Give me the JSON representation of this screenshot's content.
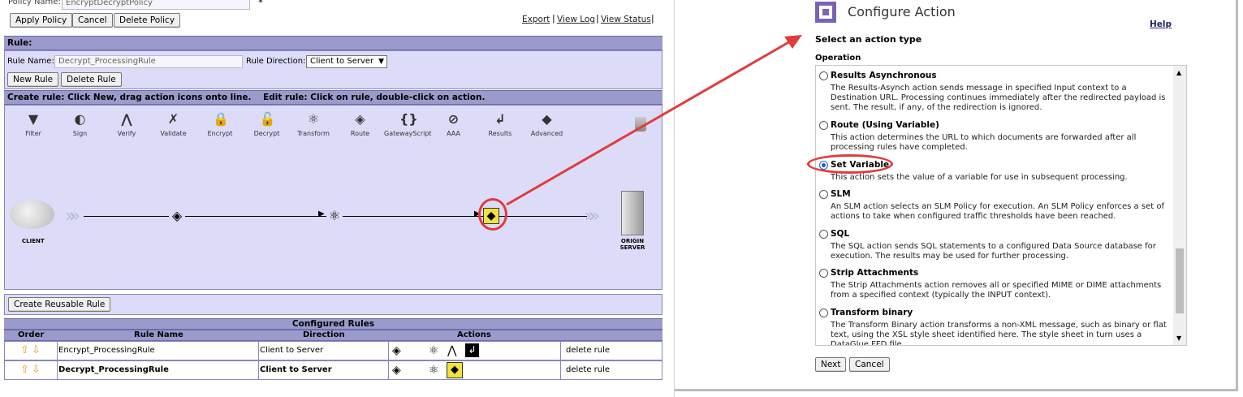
{
  "policy": {
    "name_label": "Policy Name:",
    "name_value": "EncryptDecryptPolicy",
    "required_marker": "*",
    "apply_button": "Apply Policy",
    "cancel_button": "Cancel",
    "delete_button": "Delete Policy",
    "links": [
      "Export",
      "View Log",
      "View Status"
    ]
  },
  "rule": {
    "header": "Rule:",
    "name_label": "Rule Name:",
    "name_value": "Decrypt_ProcessingRule",
    "direction_label": "Rule Direction:",
    "direction_value": "Client to Server",
    "new_button": "New Rule",
    "delete_button": "Delete Rule",
    "instructions": "Create rule: Click New, drag action icons onto line.    Edit rule: Click on rule, double-click on action.",
    "tools": [
      {
        "label": "Filter",
        "icon": "filter-icon",
        "glyph": "▼"
      },
      {
        "label": "Sign",
        "icon": "sign-icon",
        "glyph": "◐"
      },
      {
        "label": "Verify",
        "icon": "verify-icon",
        "glyph": "⋀"
      },
      {
        "label": "Validate",
        "icon": "validate-icon",
        "glyph": "✗"
      },
      {
        "label": "Encrypt",
        "icon": "encrypt-icon",
        "glyph": "🔒"
      },
      {
        "label": "Decrypt",
        "icon": "decrypt-icon",
        "glyph": "🔓"
      },
      {
        "label": "Transform",
        "icon": "transform-icon",
        "glyph": "⚛"
      },
      {
        "label": "Route",
        "icon": "route-icon",
        "glyph": "◈"
      },
      {
        "label": "GatewayScript",
        "icon": "gatewayscript-icon",
        "glyph": "{}"
      },
      {
        "label": "AAA",
        "icon": "aaa-icon",
        "glyph": "⊘"
      },
      {
        "label": "Results",
        "icon": "results-icon",
        "glyph": "↲"
      },
      {
        "label": "Advanced",
        "icon": "advanced-icon",
        "glyph": "◆"
      }
    ],
    "client_label": "CLIENT",
    "server_label": "ORIGIN SERVER",
    "reusable_button": "Create Reusable Rule"
  },
  "configured_rules": {
    "title": "Configured Rules",
    "columns": [
      "Order",
      "Rule Name",
      "Direction",
      "Actions"
    ],
    "rows": [
      {
        "name": "Encrypt_ProcessingRule",
        "direction": "Client to Server",
        "delete": "delete rule",
        "bold": false
      },
      {
        "name": "Decrypt_ProcessingRule",
        "direction": "Client to Server",
        "delete": "delete rule",
        "bold": true
      }
    ]
  },
  "dialog": {
    "title": "Configure Action",
    "help": "Help",
    "subtitle": "Select an action type",
    "section": "Operation",
    "options": [
      {
        "title": "Results Asynchronous",
        "desc": "The Results-Asynch action sends message in specified Input context to a Destination URL. Processing continues immediately after the redirected payload is sent. The result, if any, of the redirection is ignored."
      },
      {
        "title": "Route (Using Variable)",
        "desc": "This action determines the URL to which documents are forwarded after all processing rules have completed."
      },
      {
        "title": "Set Variable",
        "desc": "This action sets the value of a variable for use in subsequent processing."
      },
      {
        "title": "SLM",
        "desc": "An SLM action selects an SLM Policy for execution. An SLM Policy enforces a set of actions to take when configured traffic thresholds have been reached."
      },
      {
        "title": "SQL",
        "desc": "The SQL action sends SQL statements to a configured Data Source database for execution. The results may be used for further processing."
      },
      {
        "title": "Strip Attachments",
        "desc": "The Strip Attachments action removes all or specified MIME or DIME attachments from a specified context (typically the INPUT context)."
      },
      {
        "title": "Transform binary",
        "desc": "The Transform Binary action transforms a non-XML message, such as binary or flat text, using the XSL style sheet identified here. The style sheet in turn uses a DataGlue FFD file."
      }
    ],
    "selected_index": 2,
    "next_button": "Next",
    "cancel_button": "Cancel"
  },
  "colors": {
    "header_bar": "#9a9acb",
    "panel": "#dcdcf8",
    "highlight": "#e03c3c"
  }
}
